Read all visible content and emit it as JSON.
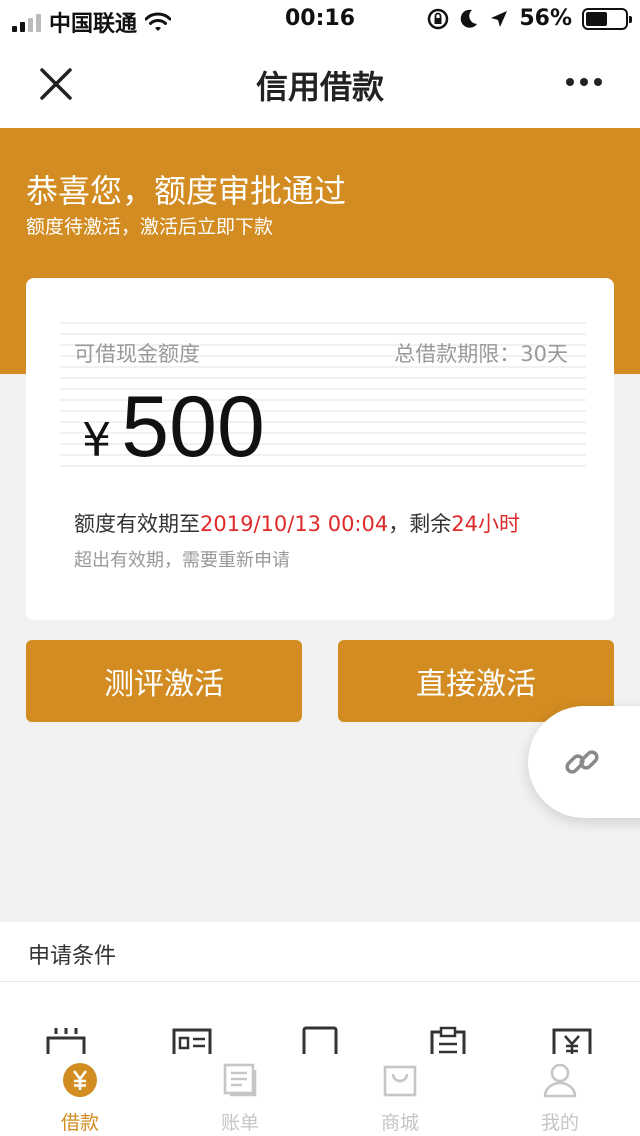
{
  "status_bar": {
    "carrier": "中国联通",
    "time": "00:16",
    "battery": "56%"
  },
  "nav": {
    "title": "信用借款",
    "close_icon": "close-icon",
    "more_icon": "more-icon"
  },
  "hero": {
    "title": "恭喜您，额度审批通过",
    "subtitle": "额度待激活，激活后立即下款"
  },
  "card": {
    "label": "可借现金额度",
    "term": "总借款期限：30天",
    "currency": "¥",
    "amount": "500",
    "validity_prefix": "额度有效期至",
    "validity_date": "2019/10/13 00:04",
    "validity_mid": "，剩余",
    "validity_remaining": "24小时",
    "note": "超出有效期，需要重新申请"
  },
  "actions": {
    "evaluate": "测评激活",
    "direct": "直接激活"
  },
  "conditions": {
    "title": "申请条件"
  },
  "tabs": [
    {
      "label": "借款",
      "icon": "yen-coin-icon",
      "active": true
    },
    {
      "label": "账单",
      "icon": "bill-icon",
      "active": false
    },
    {
      "label": "商城",
      "icon": "shopping-bag-icon",
      "active": false
    },
    {
      "label": "我的",
      "icon": "user-icon",
      "active": false
    }
  ],
  "colors": {
    "accent": "#d28c21",
    "highlight": "#e02a2a"
  }
}
